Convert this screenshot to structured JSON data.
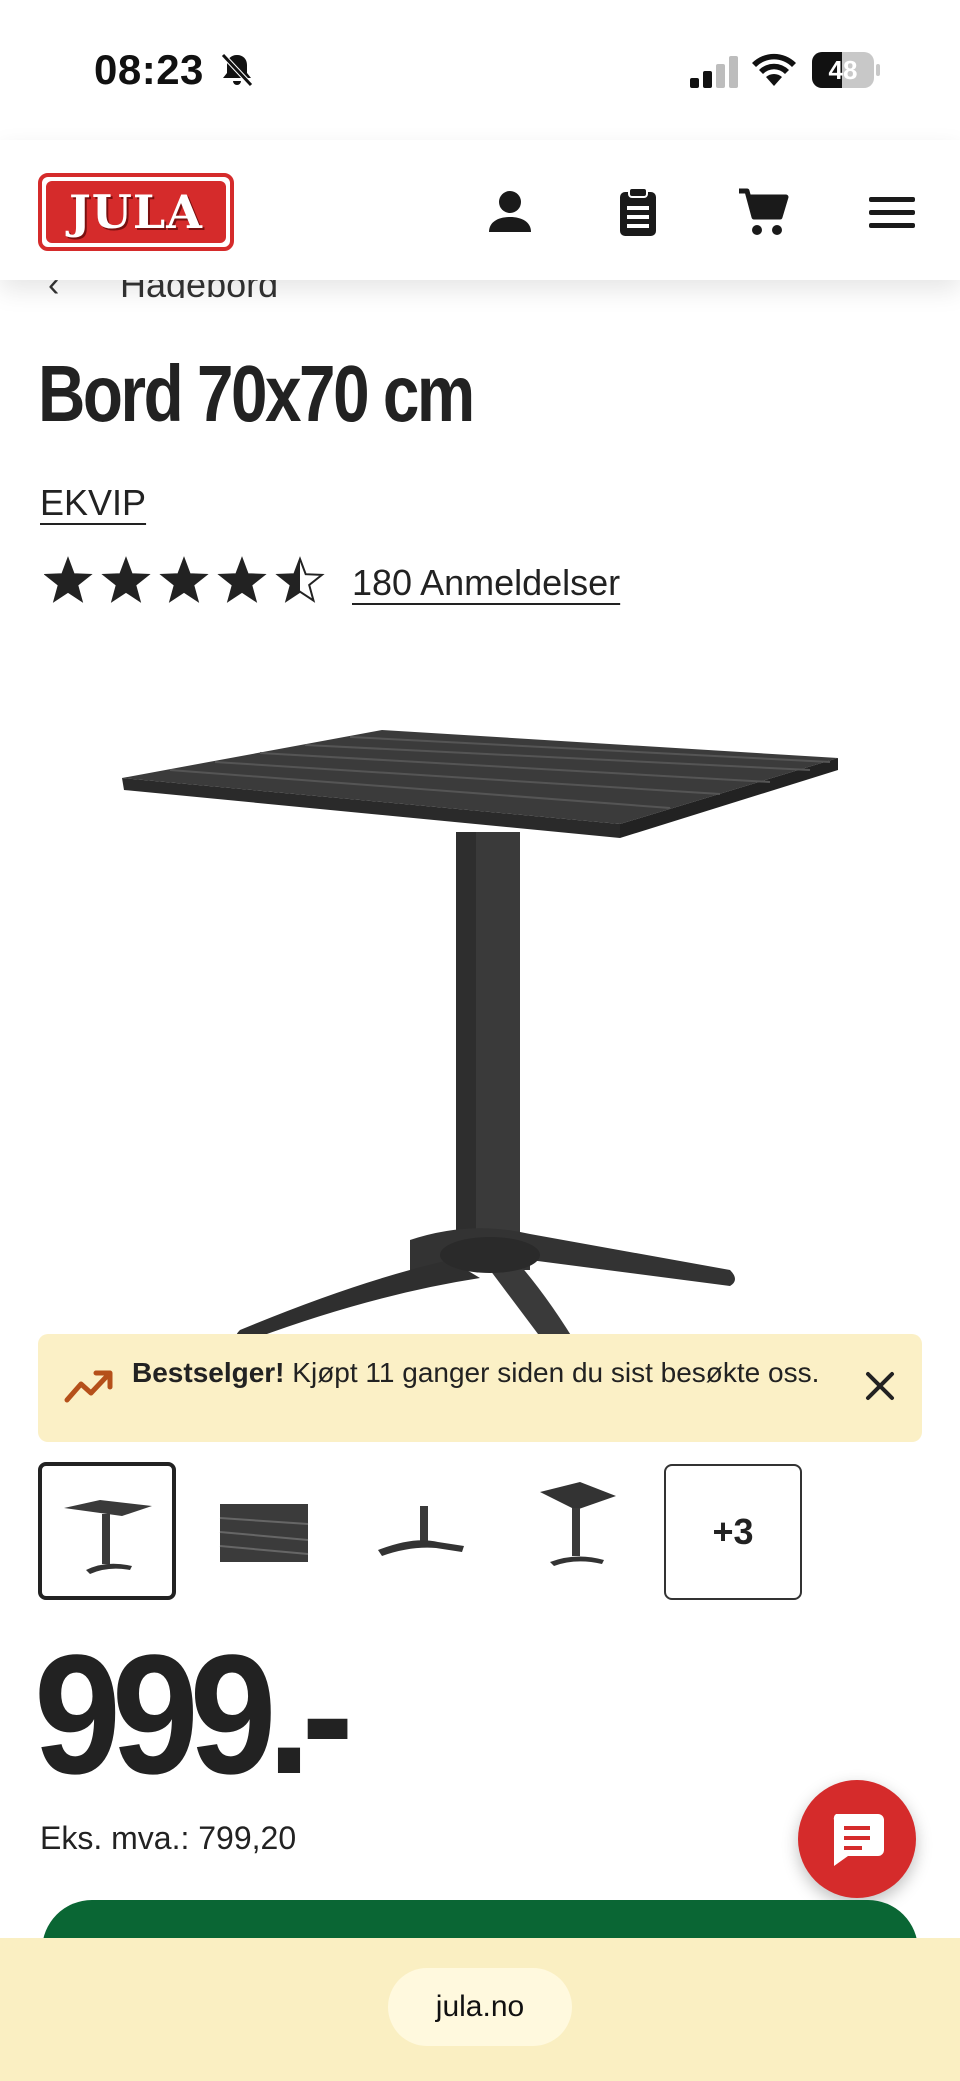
{
  "status_bar": {
    "time": "08:23",
    "battery_percent": "48",
    "battery_level": 0.48,
    "icons": [
      "bell-slash-icon",
      "cellular-signal-icon",
      "wifi-icon",
      "battery-icon"
    ]
  },
  "header": {
    "logo_text": "JULA",
    "icons": [
      "user-icon",
      "clipboard-list-icon",
      "cart-icon",
      "hamburger-menu-icon"
    ],
    "brand_color": "#d52b2b"
  },
  "breadcrumb": {
    "label": "Hagebord"
  },
  "product": {
    "title": "Bord 70x70 cm",
    "brand": "EKVIP",
    "rating": 4.5,
    "rating_max": 5,
    "reviews_label": "180 Anmeldelser",
    "image_description_icon": "patio-table-image"
  },
  "bestseller_banner": {
    "bold": "Bestselger!",
    "text": " Kjøpt 11 ganger siden du sist besøkte oss.",
    "bg_color": "#fbf0c6",
    "icon_color": "#b5501a"
  },
  "gallery": {
    "thumbnails": [
      "thumb-table-full",
      "thumb-tabletop-slats",
      "thumb-base-foot",
      "thumb-table-tilted"
    ],
    "more_label": "+3"
  },
  "pricing": {
    "price": "999.-",
    "ex_vat": "Eks. mva.: 799,20"
  },
  "browser": {
    "url": "jula.no",
    "bar_color": "#faefc2"
  },
  "colors": {
    "buy_button": "#0a6634",
    "chat_button": "#d52b2b"
  }
}
